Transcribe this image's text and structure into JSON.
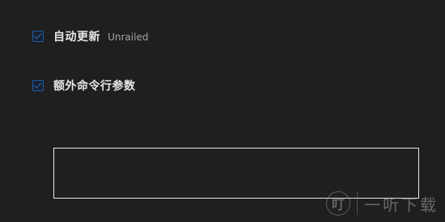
{
  "settings": {
    "auto_update": {
      "label": "自动更新",
      "sub_label": "Unrailed"
    },
    "extra_args": {
      "label": "额外命令行参数",
      "value": ""
    }
  },
  "watermark": {
    "logo_glyph": "叮",
    "text": "一听下载"
  },
  "colors": {
    "background": "#1f1f1f",
    "checkbox_border": "#1d5fa8",
    "input_border": "#e8e8e8",
    "text_primary": "#e6e6e6"
  }
}
